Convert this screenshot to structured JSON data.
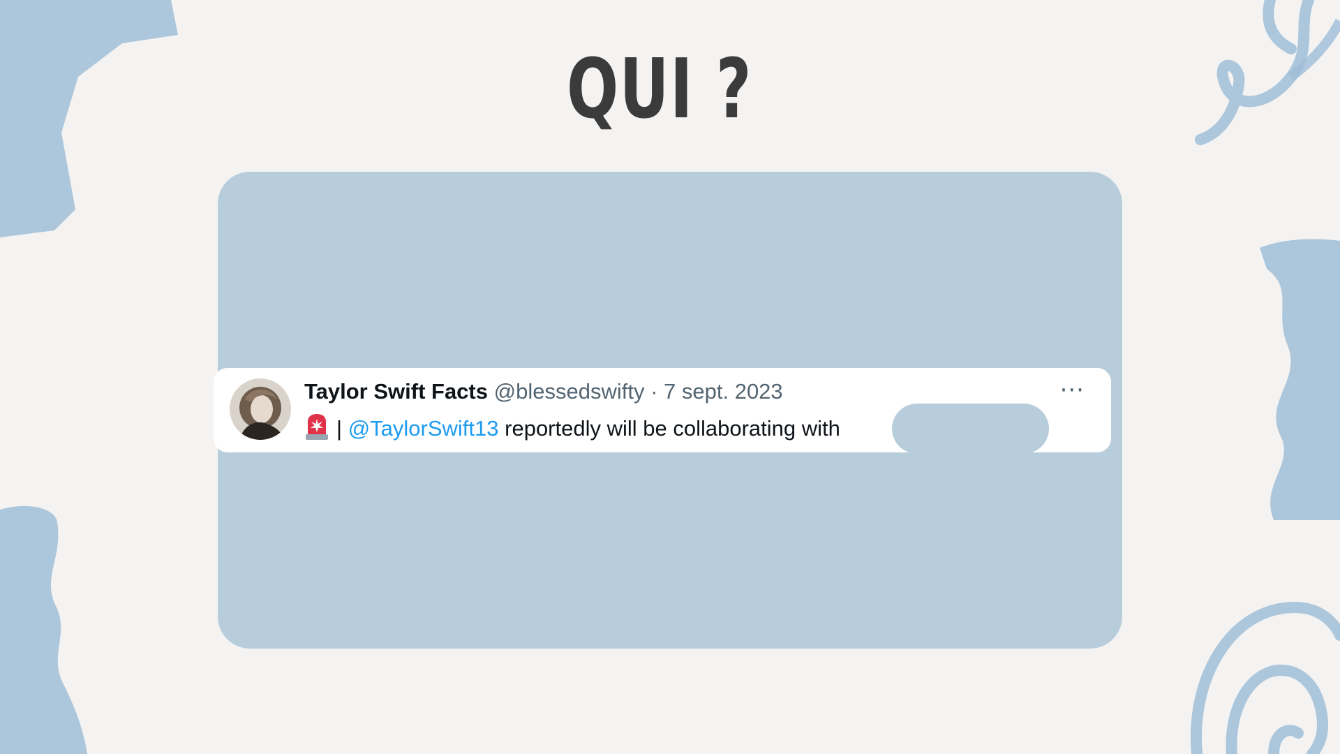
{
  "slide": {
    "title": "QUI ?"
  },
  "tweet": {
    "author_name": "Taylor Swift Facts",
    "handle": "@blessedswifty",
    "separator": "·",
    "date": "7 sept. 2023",
    "pipe": "|",
    "mention": "@TaylorSwift13",
    "text": "reportedly will be collaborating with",
    "more_label": "···",
    "avatar_icon": "profile-photo",
    "siren_icon": "rotating-light"
  },
  "colors": {
    "card_bg": "#b8cddc",
    "mention": "#1d9bf0",
    "title": "#3b3b3b",
    "watercolor": "#9fbdd8"
  }
}
